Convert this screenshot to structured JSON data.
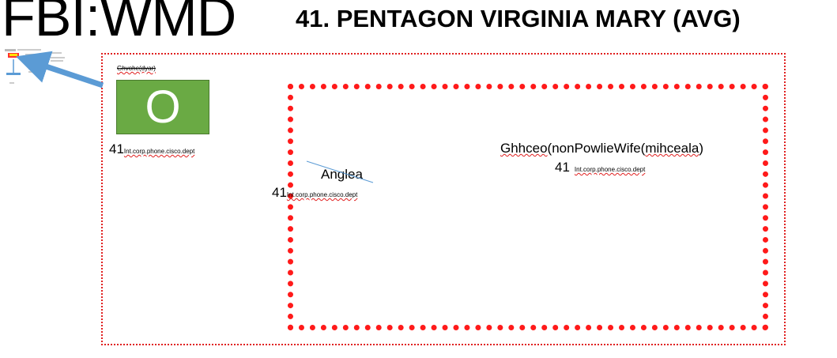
{
  "header": {
    "logo_text": "FBI:WMD",
    "title": "41. PENTAGON VIRGINIA MARY (AVG)"
  },
  "top_node": {
    "label": "Ghvohe(dyar)",
    "box_letter": "O",
    "number": "41",
    "tag": "Int.corp.phone.cisco.dept"
  },
  "left_node": {
    "name": "Anglea",
    "number": "41",
    "tag": "Int.corp.phone.cisco.dept"
  },
  "right_node": {
    "name_part1": "Ghhceo",
    "name_part2": "(nonPowlieWife(",
    "name_part3": "mihceala",
    "name_part4": ")",
    "number": "41",
    "tag": "Int.corp.phone.cisco.dept"
  },
  "colors": {
    "box_green": "#6aaa44",
    "frame_red": "#ff1a1a",
    "arrow_blue": "#5b9bd5"
  }
}
